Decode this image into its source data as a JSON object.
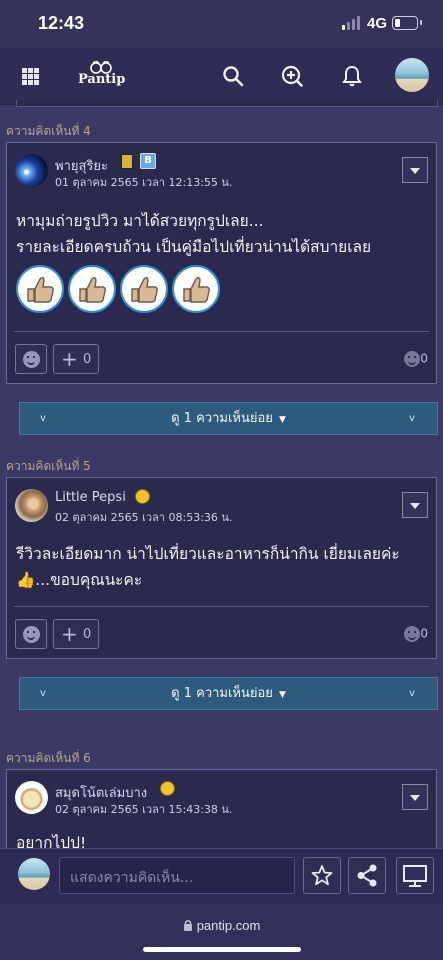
{
  "status_bar": {
    "time": "12:43",
    "network": "4G"
  },
  "nav": {
    "logo": "Pantip",
    "icons": [
      "grid-icon",
      "search-icon",
      "add-topic-icon",
      "bell-icon",
      "avatar"
    ]
  },
  "comments": [
    {
      "label": "ความคิดเห็นที่ 4",
      "author": "พายุสุริยะ",
      "date": "01 ตุลาคม 2565 เวลา 12:13:55 น.",
      "lines": [
        "หามุมถ่ายรูปวิว มาได้สวยทุกรูปเลย...",
        "รายละเอียดครบถ้วน เป็นคู่มือไปเที่ยวน่านได้สบายเลย"
      ],
      "plus_count": "0",
      "emotion_count": "0",
      "reply_label": "ดู 1 ความเห็นย่อย"
    },
    {
      "label": "ความคิดเห็นที่ 5",
      "author": "Little Pepsi",
      "date": "02 ตุลาคม 2565 เวลา 08:53:36 น.",
      "lines": [
        "รีวิวละเอียดมาก น่าไปเที่ยวและอาหารก็น่ากิน  เยี่ยมเลยค่ะ",
        "👍...ขอบคุณนะคะ"
      ],
      "plus_count": "0",
      "emotion_count": "0",
      "reply_label": "ดู 1 ความเห็นย่อย"
    },
    {
      "label": "ความคิดเห็นที่ 6",
      "author": "สมุดโน้ตเล่มบาง",
      "date": "02 ตุลาคม 2565 เวลา 15:43:38 น.",
      "lines": [
        "อยากไปป!"
      ]
    }
  ],
  "bottom_bar": {
    "placeholder": "แสดงความคิดเห็น...",
    "buttons": [
      "star-icon",
      "share-icon",
      "monitor-icon"
    ]
  },
  "browser": {
    "url": "pantip.com"
  },
  "colors": {
    "background": "#3c3a64",
    "card": "#2b2a4e",
    "accent_blue": "#2e5a7e",
    "label": "#b8a684"
  }
}
